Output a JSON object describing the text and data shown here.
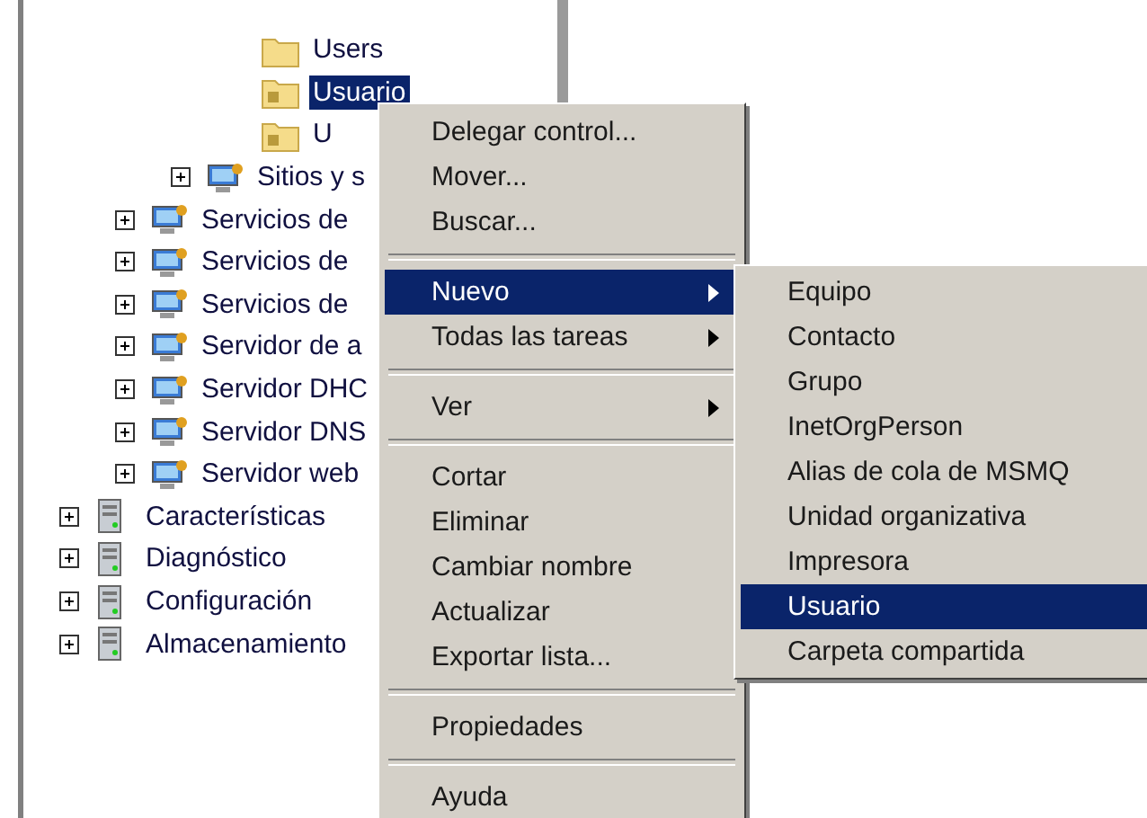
{
  "tree": {
    "items": [
      {
        "children": [
          {
            "children": [
              {
                "children": [
                  {
                    "label": "Users",
                    "kind": "folder",
                    "collapsed": false,
                    "selected": false
                  },
                  {
                    "label": "Usuario",
                    "kind": "ou-folder",
                    "collapsed": false,
                    "selected": true
                  },
                  {
                    "label": "U",
                    "kind": "ou-folder",
                    "collapsed": false,
                    "selected": false
                  }
                ]
              },
              {
                "label": "Sitios y s",
                "kind": "snapin",
                "collapsed": true,
                "selected": false
              }
            ]
          },
          {
            "label": "Servicios de",
            "kind": "snapin",
            "collapsed": true,
            "selected": false
          },
          {
            "label": "Servicios de",
            "kind": "snapin",
            "collapsed": true,
            "selected": false
          },
          {
            "label": "Servicios de",
            "kind": "snapin",
            "collapsed": true,
            "selected": false
          },
          {
            "label": "Servidor de a",
            "kind": "snapin",
            "collapsed": true,
            "selected": false
          },
          {
            "label": "Servidor DHC",
            "kind": "snapin",
            "collapsed": true,
            "selected": false
          },
          {
            "label": "Servidor DNS",
            "kind": "snapin",
            "collapsed": true,
            "selected": false
          },
          {
            "label": "Servidor web",
            "kind": "snapin",
            "collapsed": true,
            "selected": false
          }
        ]
      },
      {
        "label": "Características",
        "kind": "server",
        "collapsed": true,
        "selected": false
      },
      {
        "label": "Diagnóstico",
        "kind": "server",
        "collapsed": true,
        "selected": false
      },
      {
        "label": "Configuración",
        "kind": "server",
        "collapsed": true,
        "selected": false
      },
      {
        "label": "Almacenamiento",
        "kind": "server",
        "collapsed": true,
        "selected": false
      }
    ]
  },
  "context_menu": {
    "items": [
      {
        "kind": "item",
        "label": "Delegar control...",
        "selected": false,
        "has_submenu": false
      },
      {
        "kind": "item",
        "label": "Mover...",
        "selected": false,
        "has_submenu": false
      },
      {
        "kind": "item",
        "label": "Buscar...",
        "selected": false,
        "has_submenu": false
      },
      {
        "kind": "separator"
      },
      {
        "kind": "item",
        "label": "Nuevo",
        "selected": true,
        "has_submenu": true
      },
      {
        "kind": "item",
        "label": "Todas las tareas",
        "selected": false,
        "has_submenu": true
      },
      {
        "kind": "separator"
      },
      {
        "kind": "item",
        "label": "Ver",
        "selected": false,
        "has_submenu": true
      },
      {
        "kind": "separator"
      },
      {
        "kind": "item",
        "label": "Cortar",
        "selected": false,
        "has_submenu": false
      },
      {
        "kind": "item",
        "label": "Eliminar",
        "selected": false,
        "has_submenu": false
      },
      {
        "kind": "item",
        "label": "Cambiar nombre",
        "selected": false,
        "has_submenu": false
      },
      {
        "kind": "item",
        "label": "Actualizar",
        "selected": false,
        "has_submenu": false
      },
      {
        "kind": "item",
        "label": "Exportar lista...",
        "selected": false,
        "has_submenu": false
      },
      {
        "kind": "separator"
      },
      {
        "kind": "item",
        "label": "Propiedades",
        "selected": false,
        "has_submenu": false
      },
      {
        "kind": "separator"
      },
      {
        "kind": "item",
        "label": "Ayuda",
        "selected": false,
        "has_submenu": false
      }
    ]
  },
  "submenu": {
    "items": [
      {
        "label": "Equipo",
        "selected": false
      },
      {
        "label": "Contacto",
        "selected": false
      },
      {
        "label": "Grupo",
        "selected": false
      },
      {
        "label": "InetOrgPerson",
        "selected": false
      },
      {
        "label": "Alias de cola de MSMQ",
        "selected": false
      },
      {
        "label": "Unidad organizativa",
        "selected": false
      },
      {
        "label": "Impresora",
        "selected": false
      },
      {
        "label": "Usuario",
        "selected": true
      },
      {
        "label": "Carpeta compartida",
        "selected": false
      }
    ]
  }
}
